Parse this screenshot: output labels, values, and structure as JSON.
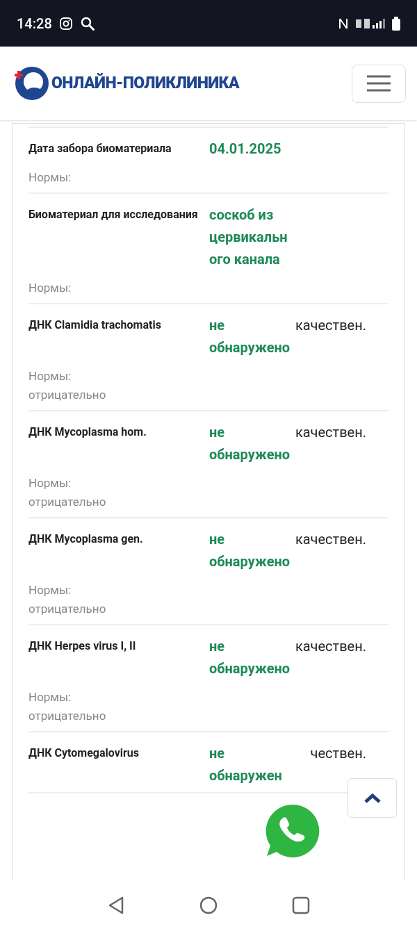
{
  "status_bar": {
    "time": "14:28"
  },
  "header": {
    "logo_text": "ОНЛАЙН-ПОЛИКЛИНИКА"
  },
  "results": [
    {
      "label": "Дата забора биоматериала",
      "value": "04.01.2025",
      "norms_label": "Нормы:"
    },
    {
      "label": "Биоматериал для исследования",
      "value": "соскоб из цервикального канала",
      "norms_label": "Нормы:"
    },
    {
      "label": "ДНК Clamidia trachomatis",
      "value": "не обнаружено",
      "unit": "качествен.",
      "norms_label": "Нормы:",
      "norms_value": "отрицательно"
    },
    {
      "label": "ДНК Mycoplasma hom.",
      "value": "не обнаружено",
      "unit": "качествен.",
      "norms_label": "Нормы:",
      "norms_value": "отрицательно"
    },
    {
      "label": "ДНК Mycoplasma gen.",
      "value": "не обнаружено",
      "unit": "качествен.",
      "norms_label": "Нормы:",
      "norms_value": "отрицательно"
    },
    {
      "label": "ДНК Herpes virus I, II",
      "value": "не обнаружено",
      "unit": "качествен.",
      "norms_label": "Нормы:",
      "norms_value": "отрицательно"
    },
    {
      "label": "ДНК Cytomegalovirus",
      "value": "не обнаружен",
      "unit": "чествен."
    }
  ]
}
